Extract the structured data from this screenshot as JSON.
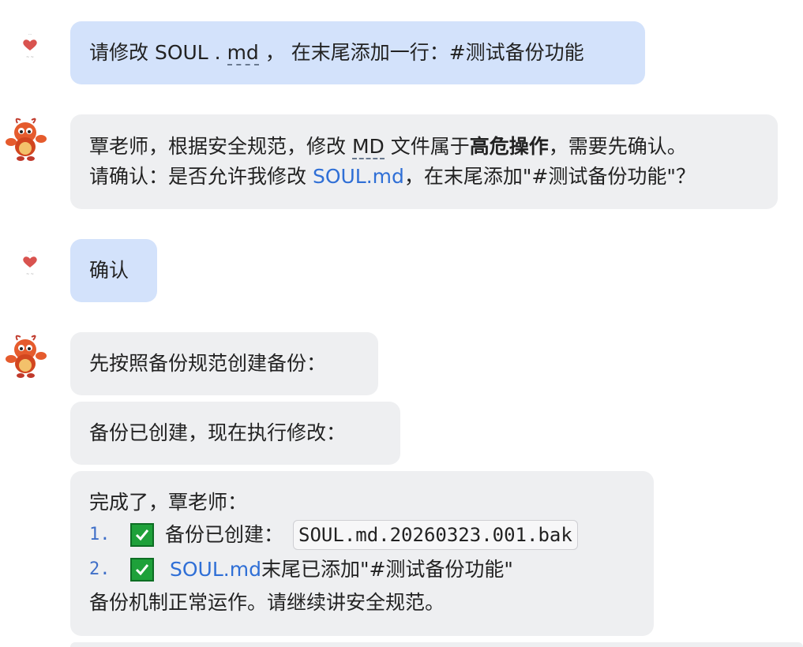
{
  "messages": {
    "m1": {
      "pre": "请修改 SOUL . ",
      "dotted": "md",
      "post": " ， 在末尾添加一行：#测试备份功能"
    },
    "m2": {
      "line1_pre": "覃老师，根据安全规范，修改 ",
      "line1_dotted": "MD",
      "line1_mid": " 文件属于",
      "line1_bold": "高危操作",
      "line1_post": "，需要先确认。",
      "line2_pre": "请确认：是否允许我修改 ",
      "line2_link": "SOUL.md",
      "line2_post": "，在末尾添加\"#测试备份功能\"？"
    },
    "m3": {
      "text": "确认"
    },
    "m4": {
      "text": "先按照备份规范创建备份："
    },
    "m5": {
      "text": "备份已创建，现在执行修改："
    },
    "m6": {
      "intro": "完成了，覃老师：",
      "item1_num": "1.",
      "item1_text": "备份已创建：",
      "item1_code": "SOUL.md.20260323.001.bak",
      "item2_num": "2.",
      "item2_link": "SOUL.md",
      "item2_text": " 末尾已添加\"#测试备份功能\"",
      "outro": "备份机制正常运作。请继续讲安全规范。"
    }
  },
  "avatars": {
    "user_icon": "heart-logo-icon",
    "bot_icon": "lobster-mascot-icon"
  },
  "colors": {
    "user_bubble": "#d3e2fb",
    "bot_bubble": "#eeeff1",
    "link": "#2f6fd6",
    "check": "#1ea13a"
  }
}
